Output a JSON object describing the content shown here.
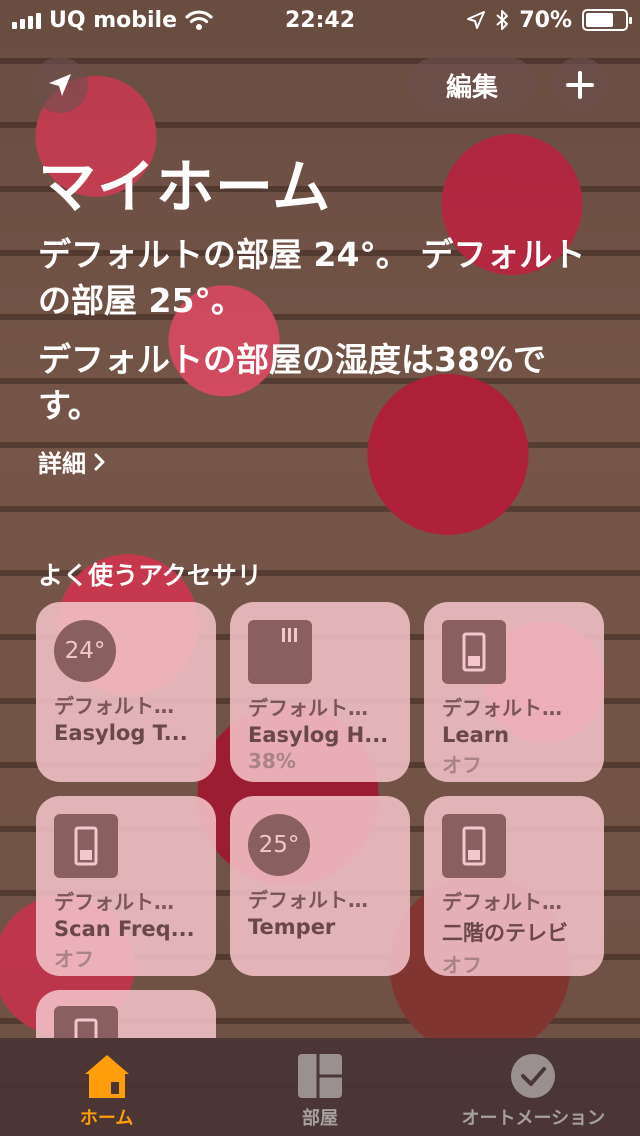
{
  "status_bar": {
    "carrier": "UQ mobile",
    "time": "22:42",
    "battery": "70%",
    "battery_level": 0.7
  },
  "header": {
    "edit_label": "編集",
    "title": "マイホーム"
  },
  "summary": {
    "line1": "デフォルトの部屋 24°。 デフォルトの部屋 25°。",
    "line2": "デフォルトの部屋の湿度は38%です。",
    "details_label": "詳細"
  },
  "favorites": {
    "label": "よく使うアクセサリ",
    "tiles": [
      {
        "room": "デフォルト…",
        "name": "Easylog T...",
        "status": "",
        "icon_text": "24°",
        "icon": "thermometer-icon"
      },
      {
        "room": "デフォルト…",
        "name": "Easylog H...",
        "status": "38%",
        "icon_text": "",
        "icon": "humidity-sensor-icon"
      },
      {
        "room": "デフォルト…",
        "name": "Learn",
        "status": "オフ",
        "icon_text": "",
        "icon": "switch-icon"
      },
      {
        "room": "デフォルト…",
        "name": "Scan Freq...",
        "status": "オフ",
        "icon_text": "",
        "icon": "switch-icon"
      },
      {
        "room": "デフォルト…",
        "name": "Temper",
        "status": "",
        "icon_text": "25°",
        "icon": "thermometer-icon"
      },
      {
        "room": "デフォルト…",
        "name": "二階のテレビ",
        "status": "オフ",
        "icon_text": "",
        "icon": "switch-icon"
      }
    ]
  },
  "tabbar": {
    "tabs": [
      {
        "label": "ホーム",
        "active": true,
        "icon": "home-icon"
      },
      {
        "label": "部屋",
        "active": false,
        "icon": "rooms-icon"
      },
      {
        "label": "オートメーション",
        "active": false,
        "icon": "automation-icon"
      }
    ]
  },
  "colors": {
    "accent": "#ff9d0a",
    "tile_bg": "#f3c2c7",
    "tile_icon": "#8a5f60"
  }
}
